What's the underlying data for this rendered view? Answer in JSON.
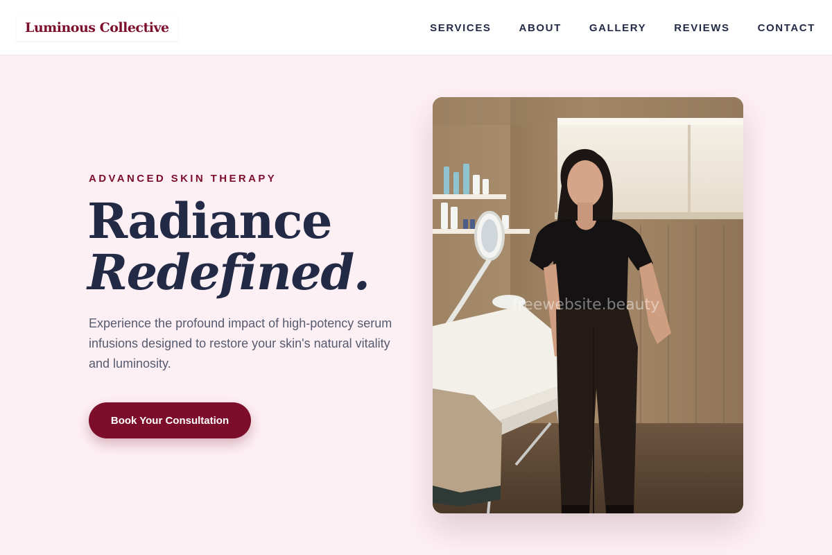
{
  "header": {
    "logo": "Luminous Collective",
    "nav": [
      "SERVICES",
      "ABOUT",
      "GALLERY",
      "REVIEWS",
      "CONTACT"
    ]
  },
  "hero": {
    "eyebrow": "ADVANCED SKIN THERAPY",
    "title_line1": "Radiance",
    "title_line2": "Redefined.",
    "description": "Experience the profound impact of high-potency serum infusions designed to restore your skin's natural vitality and luminosity.",
    "cta_label": "Book Your Consultation"
  },
  "photo": {
    "watermark": "freewebsite.beauty"
  },
  "colors": {
    "brand": "#7c0e2c",
    "page_background": "#fdf0f4",
    "heading": "#232a45",
    "body_text": "#555a6e"
  }
}
